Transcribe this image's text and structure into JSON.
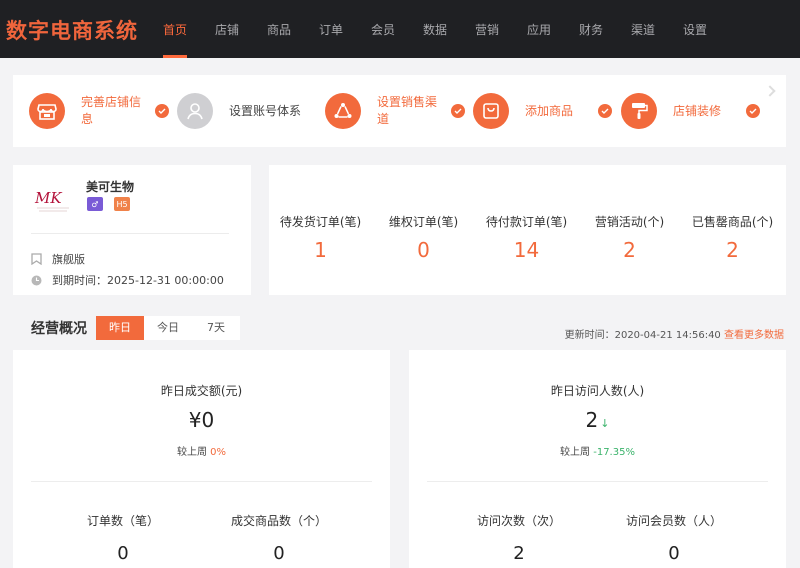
{
  "brand": "数字电商系统",
  "nav": [
    "首页",
    "店铺",
    "商品",
    "订单",
    "会员",
    "数据",
    "营销",
    "应用",
    "财务",
    "渠道",
    "设置"
  ],
  "steps": [
    {
      "line1": "完善店铺信",
      "line2": "息",
      "icon": "store-icon",
      "done": true
    },
    {
      "line1": "设置账号体系",
      "line2": "",
      "icon": "user-icon",
      "done": false
    },
    {
      "line1": "设置销售渠",
      "line2": "道",
      "icon": "channel-icon",
      "done": true
    },
    {
      "line1": "添加商品",
      "line2": "",
      "icon": "bag-icon",
      "done": true
    },
    {
      "line1": "店铺装修",
      "line2": "",
      "icon": "paint-roller-icon",
      "done": true
    }
  ],
  "store": {
    "name": "美可生物",
    "logo_text": "MK",
    "badge_mini": "♂",
    "badge_h5": "H5",
    "edition": "旗舰版",
    "expiry": "到期时间：2025-12-31 00:00:00"
  },
  "stats": [
    {
      "label": "待发货订单(笔)",
      "value": "1"
    },
    {
      "label": "维权订单(笔)",
      "value": "0"
    },
    {
      "label": "待付款订单(笔)",
      "value": "14"
    },
    {
      "label": "营销活动(个)",
      "value": "2"
    },
    {
      "label": "已售罄商品(个)",
      "value": "2"
    }
  ],
  "overview": {
    "title": "经营概况",
    "tabs": [
      "昨日",
      "今日",
      "7天"
    ],
    "active_tab": "昨日",
    "update_time": "更新时间：2020-04-21 14:56:40",
    "more_link": "查看更多数据"
  },
  "cards": [
    {
      "title": "昨日成交额(元)",
      "value": "¥0",
      "arrow": "",
      "compare_label": "较上周",
      "compare_value": "0%",
      "compare_color": "#f26a3c",
      "subs": [
        {
          "label": "订单数（笔）",
          "value": "0"
        },
        {
          "label": "成交商品数（个）",
          "value": "0"
        }
      ]
    },
    {
      "title": "昨日访问人数(人)",
      "value": "2",
      "arrow": "↓",
      "compare_label": "较上周",
      "compare_value": "-17.35%",
      "compare_color": "#3bb36b",
      "subs": [
        {
          "label": "访问次数（次）",
          "value": "2"
        },
        {
          "label": "访问会员数（人）",
          "value": "0"
        }
      ]
    }
  ],
  "colors": {
    "accent": "#f26a3c",
    "topbar": "#1f2023",
    "positive": "#3bb36b"
  }
}
